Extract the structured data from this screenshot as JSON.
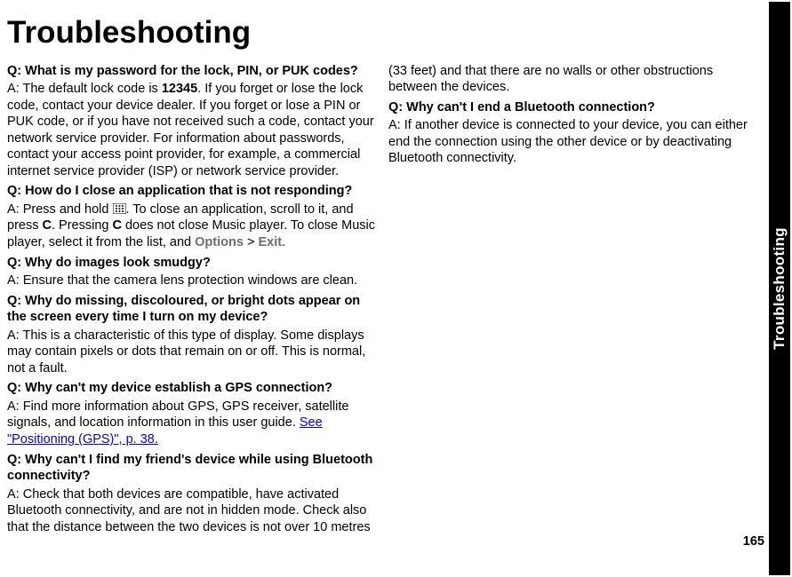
{
  "title": "Troubleshooting",
  "side_label": "Troubleshooting",
  "page_number": "165",
  "q1": "Q: What is my password for the lock, PIN, or PUK codes?",
  "a1_p1": "A: The default lock code is ",
  "a1_code": "12345",
  "a1_p2": ". If you forget or lose the lock code, contact your device dealer. If you forget or lose a PIN or PUK code, or if you have not received such a code, contact your network service provider. For information about passwords, contact your access point provider, for example, a commercial internet service provider (ISP) or network service provider.",
  "q2": "Q: How do I close an application that is not responding?",
  "a2_p1": "A: Press and hold ",
  "a2_p2": ". To close an application, scroll to it, and press ",
  "a2_c": "C",
  "a2_p3": ". Pressing ",
  "a2_p4": " does not close Music player. To close Music player, select it from the list, and ",
  "a2_options": "Options",
  "a2_gt": " > ",
  "a2_exit": "Exit",
  "a2_p5": ".",
  "q3": "Q: Why do images look smudgy?",
  "a3": "A: Ensure that the camera lens protection windows are clean.",
  "q4": "Q: Why do missing, discoloured, or bright dots appear on the screen every time I turn on my device?",
  "a4": "A: This is a characteristic of this type of display. Some displays may contain pixels or dots that remain on or off. This is normal, not a fault.",
  "q5": "Q: Why can't my device establish a GPS connection?",
  "a5_p1": "A: Find more information about GPS, GPS receiver, satellite signals, and location information in this user guide. ",
  "a5_link": "See \"Positioning (GPS)\", p. 38.",
  "q6": "Q: Why can't I find my friend's device while using Bluetooth connectivity?",
  "a6": "A: Check that both devices are compatible, have activated Bluetooth connectivity, and are not in hidden mode. Check also that the distance between the two devices is not over 10 metres (33 feet) and that there are no walls or other obstructions between the devices.",
  "q7": "Q: Why can't I end a Bluetooth connection?",
  "a7": "A: If another device is connected to your device, you can either end the connection using the other device or by deactivating Bluetooth connectivity."
}
